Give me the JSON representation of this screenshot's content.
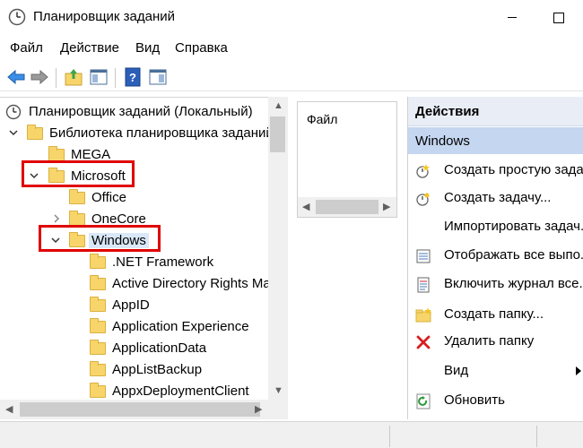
{
  "window": {
    "title": "Планировщик заданий"
  },
  "menu": {
    "items": [
      "Файл",
      "Действие",
      "Вид",
      "Справка"
    ]
  },
  "toolbar": {
    "buttons": [
      "back-arrow-icon",
      "forward-arrow-icon",
      "up-folder-icon",
      "show-hide-tree-icon",
      "help-icon",
      "action-pane-icon"
    ]
  },
  "tree": {
    "root": "Планировщик заданий (Локальный)",
    "library": "Библиотека планировщика заданий",
    "items": [
      {
        "label": "MEGA"
      },
      {
        "label": "Microsoft"
      },
      {
        "label": "Office"
      },
      {
        "label": "OneCore"
      },
      {
        "label": "Windows"
      },
      {
        "label": ".NET Framework"
      },
      {
        "label": "Active Directory Rights Ma"
      },
      {
        "label": "AppID"
      },
      {
        "label": "Application Experience"
      },
      {
        "label": "ApplicationData"
      },
      {
        "label": "AppListBackup"
      },
      {
        "label": "AppxDeploymentClient"
      }
    ]
  },
  "middle": {
    "label": "Файл"
  },
  "actions": {
    "header": "Действия",
    "section": "Windows",
    "items": [
      {
        "label": "Создать простую зада...",
        "icon": "create-basic-task-icon"
      },
      {
        "label": "Создать задачу...",
        "icon": "create-task-icon"
      },
      {
        "label": "Импортировать задач...",
        "icon": ""
      },
      {
        "label": "Отображать все выпо...",
        "icon": "display-running-tasks-icon"
      },
      {
        "label": "Включить журнал все...",
        "icon": "enable-history-icon"
      },
      {
        "label": "Создать папку...",
        "icon": "new-folder-icon"
      },
      {
        "label": "Удалить папку",
        "icon": "delete-icon"
      },
      {
        "label": "Вид",
        "icon": ""
      },
      {
        "label": "Обновить",
        "icon": "refresh-icon"
      }
    ]
  },
  "colors": {
    "highlight": "#e00000",
    "selected_band": "#c4d6f0",
    "header_bg": "#e9eef6",
    "folder": "#f7d56b"
  }
}
